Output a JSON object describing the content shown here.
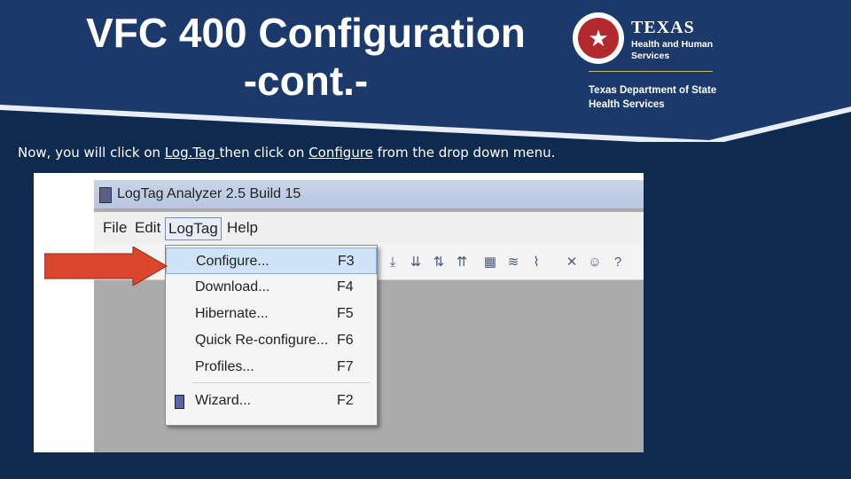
{
  "slide": {
    "title_line1": "VFC 400 Configuration",
    "title_line2": "-cont.-",
    "logo": {
      "brand": "TEXAS",
      "sub": "Health and Human Services",
      "dept": "Texas Department of State Health Services"
    },
    "instruction": {
      "part1": "Now, you will click on ",
      "link1": "Log.Tag ",
      "part2": "then click on ",
      "link2": "Configure",
      "part3": " from the drop down menu."
    }
  },
  "app": {
    "window_title": "LogTag Analyzer 2.5 Build 15",
    "menu": [
      "File",
      "Edit",
      "LogTag",
      "Help"
    ],
    "active_menu": "LogTag",
    "dropdown": [
      {
        "label": "Configure...",
        "shortcut": "F3",
        "selected": true
      },
      {
        "label": "Download...",
        "shortcut": "F4"
      },
      {
        "label": "Hibernate...",
        "shortcut": "F5"
      },
      {
        "label": "Quick Re-configure...",
        "shortcut": "F6"
      },
      {
        "label": "Profiles...",
        "shortcut": "F7"
      },
      {
        "label": "Wizard...",
        "shortcut": "F2"
      }
    ]
  },
  "colors": {
    "background": "#0f2a4f",
    "arrow": "#d9462b",
    "highlight": "#cfe3f8"
  }
}
